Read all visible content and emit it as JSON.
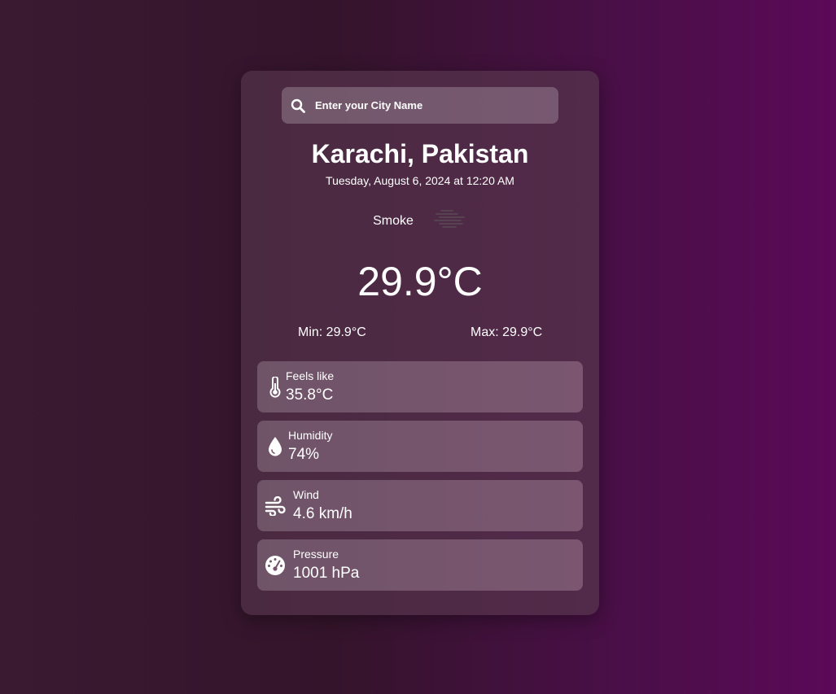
{
  "search": {
    "placeholder": "Enter your City Name",
    "icon": "search-icon"
  },
  "location": {
    "city": "Karachi, Pakistan",
    "datetime": "Tuesday, August 6, 2024 at 12:20 AM"
  },
  "weather": {
    "condition": "Smoke",
    "condition_icon": "smoke-haze-icon",
    "temperature": "29.9°C",
    "min": "Min: 29.9°C",
    "max": "Max: 29.9°C"
  },
  "stats": [
    {
      "label": "Feels like",
      "value": "35.8°C",
      "icon": "thermometer-icon"
    },
    {
      "label": "Humidity",
      "value": "74%",
      "icon": "water-drop-icon"
    },
    {
      "label": "Wind",
      "value": "4.6 km/h",
      "icon": "wind-icon"
    },
    {
      "label": "Pressure",
      "value": "1001 hPa",
      "icon": "gauge-icon"
    }
  ],
  "colors": {
    "background_start": "#3a1a31",
    "background_end": "#5b0958",
    "card": "#4d2a44",
    "stat_tile": "#735469"
  }
}
